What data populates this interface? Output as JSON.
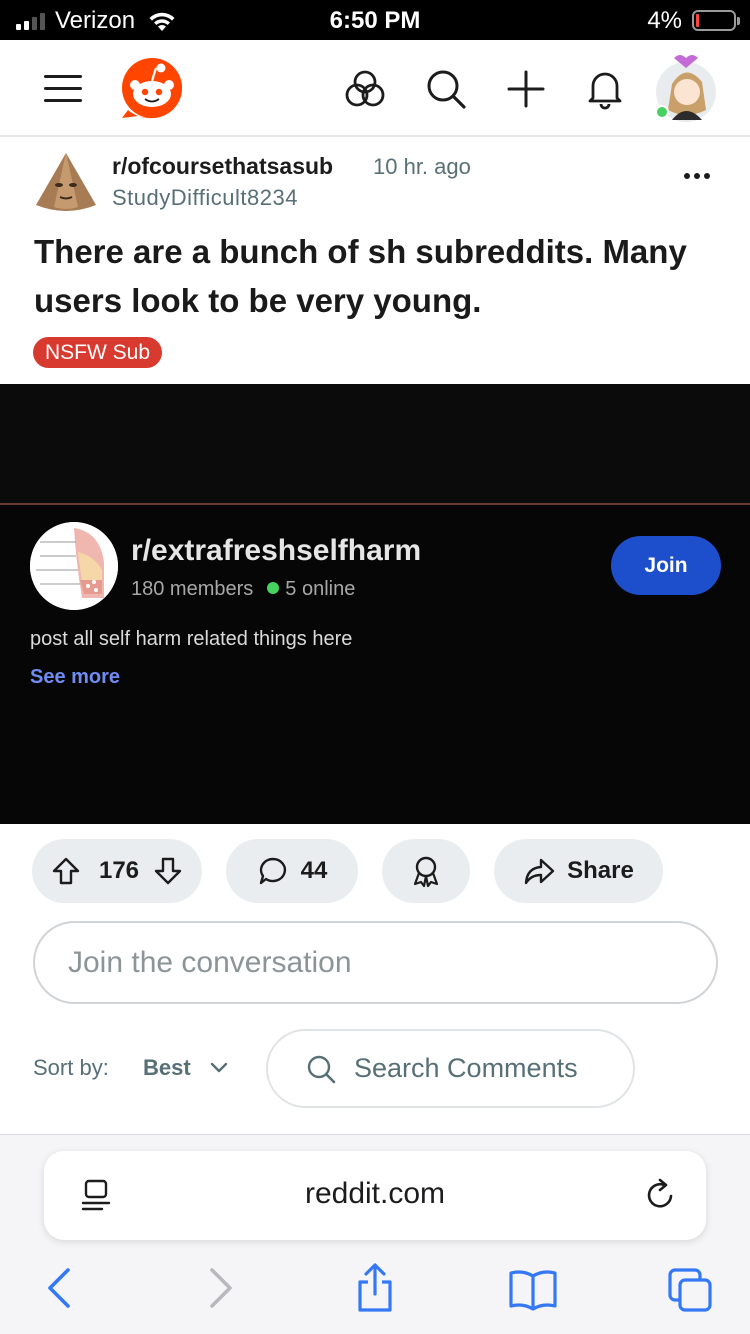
{
  "status_bar": {
    "carrier": "Verizon",
    "time": "6:50 PM",
    "battery_percent": "4%"
  },
  "header": {
    "icons": [
      "menu-icon",
      "reddit-logo",
      "popular-icon",
      "search-icon",
      "plus-icon",
      "bell-icon",
      "avatar"
    ]
  },
  "post": {
    "subreddit": "r/ofcoursethatsasub",
    "time_ago": "10 hr. ago",
    "author": "StudyDifficult8234",
    "title": "There are a bunch of sh subreddits. Many users look to be very young.",
    "badge": "NSFW Sub"
  },
  "image": {
    "subreddit": "r/extrafreshselfharm",
    "members": "180 members",
    "online": "5 online",
    "join_label": "Join",
    "description": "post all self harm related things here",
    "see_more": "See more"
  },
  "actions": {
    "score": "176",
    "comments": "44",
    "share_label": "Share"
  },
  "comment_box": {
    "placeholder": "Join the conversation"
  },
  "sort": {
    "label": "Sort by:",
    "value": "Best",
    "search_placeholder": "Search Comments"
  },
  "browser": {
    "url": "reddit.com"
  },
  "colors": {
    "reddit_orange": "#ff4500",
    "nsfw_red": "#d93a2f",
    "join_blue": "#1d4fcc",
    "link_blue": "#6f8cf3",
    "safari_blue": "#3478f6"
  }
}
